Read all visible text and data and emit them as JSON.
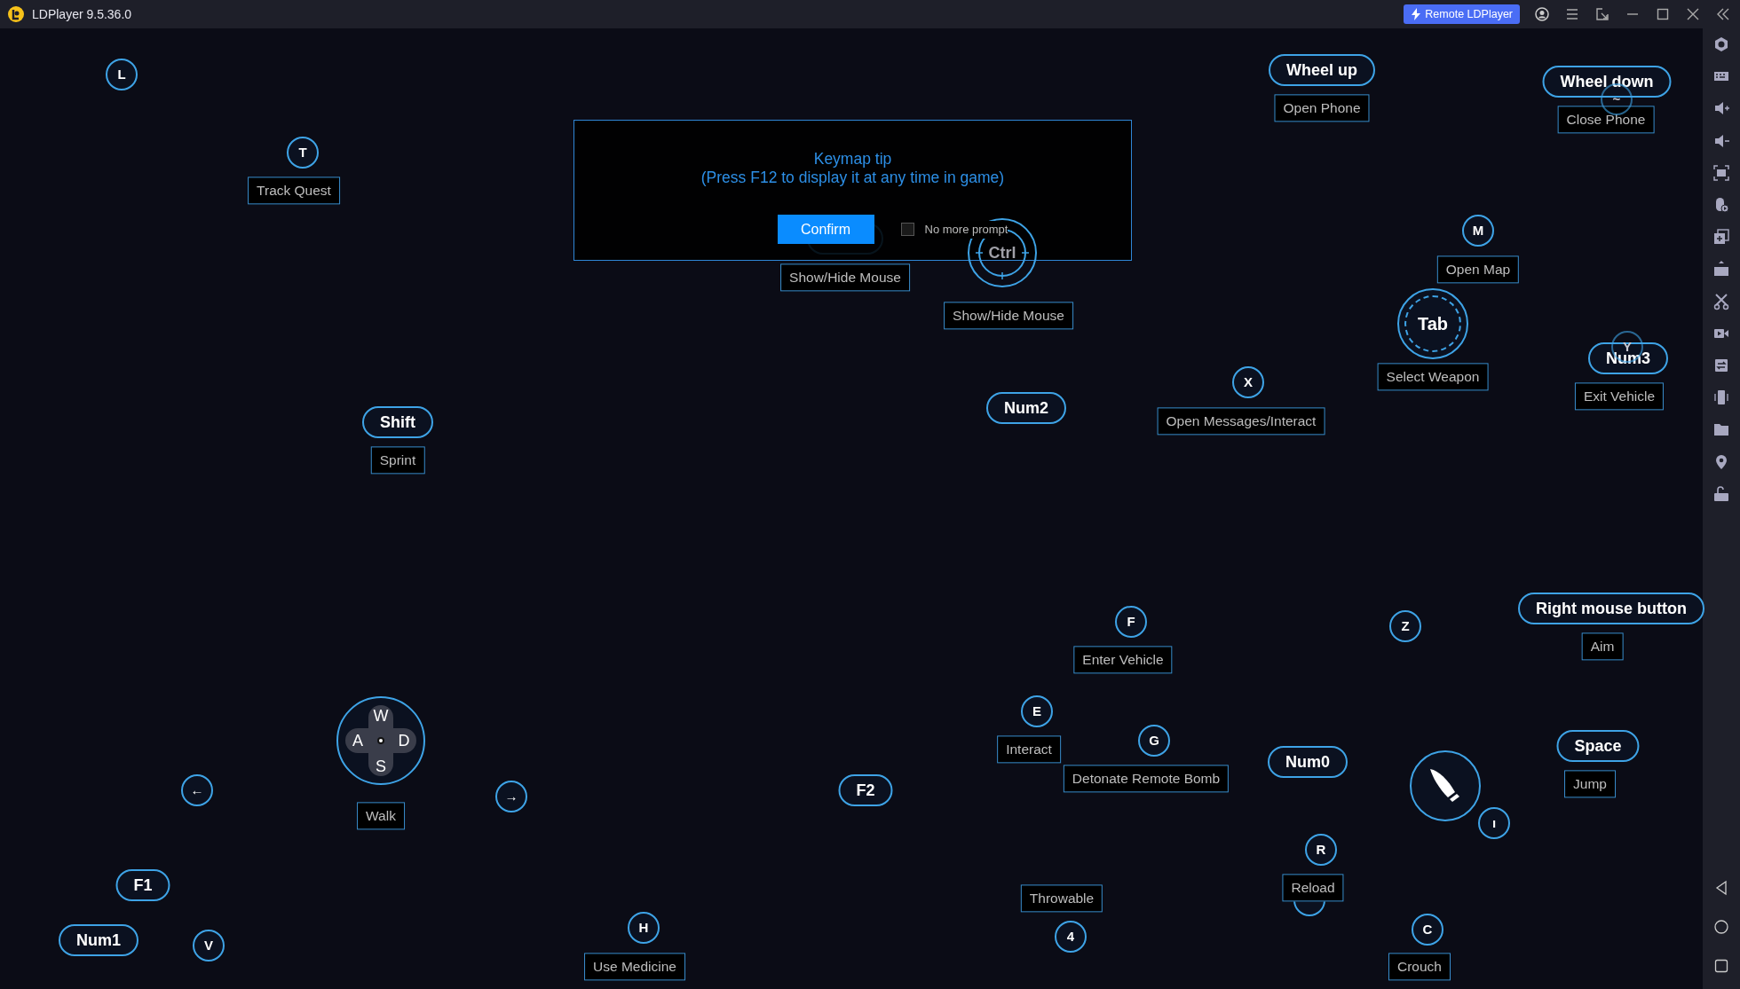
{
  "title_bar": {
    "title": "LDPlayer 9.5.36.0",
    "remote_button": "Remote LDPlayer"
  },
  "dialog": {
    "title": "Keymap tip",
    "subtitle": "(Press F12 to display it at any time in game)",
    "confirm": "Confirm",
    "checkbox": {
      "label": "No more prompt",
      "checked": false
    }
  },
  "keys": [
    {
      "kind": "circle",
      "key": "L"
    },
    {
      "kind": "circle",
      "key": "T",
      "action": "Track Quest"
    },
    {
      "kind": "pill",
      "key": "Wheel up",
      "action": "Open Phone"
    },
    {
      "kind": "pill",
      "key": "Wheel down",
      "action": "Close Phone"
    },
    {
      "kind": "ghost",
      "key": "~"
    },
    {
      "kind": "pill",
      "action": "Show/Hide Mouse"
    },
    {
      "kind": "aim",
      "key": "Ctrl",
      "action": "Show/Hide Mouse"
    },
    {
      "kind": "circle",
      "key": "M",
      "action": "Open Map"
    },
    {
      "kind": "ring",
      "key": "Tab",
      "action": "Select Weapon"
    },
    {
      "kind": "ghost",
      "key": "Y"
    },
    {
      "kind": "pill",
      "key": "Num3",
      "action": "Exit Vehicle"
    },
    {
      "kind": "pill",
      "key": "Num2"
    },
    {
      "kind": "circle",
      "key": "X",
      "action": "Open Messages/Interact"
    },
    {
      "kind": "pill",
      "key": "Shift",
      "action": "Sprint"
    },
    {
      "kind": "circle",
      "key": "F",
      "action": "Enter Vehicle"
    },
    {
      "kind": "circle",
      "key": "Z"
    },
    {
      "kind": "pill",
      "key": "Right mouse button",
      "action": "Aim"
    },
    {
      "kind": "joystick",
      "keys": [
        "W",
        "A",
        "S",
        "D"
      ],
      "action": "Walk"
    },
    {
      "kind": "circle",
      "key": "←"
    },
    {
      "kind": "circle",
      "key": "→"
    },
    {
      "kind": "pill",
      "key": "F2"
    },
    {
      "kind": "circle",
      "key": "E",
      "action": "Interact"
    },
    {
      "kind": "circle",
      "key": "G",
      "action": "Detonate Remote Bomb"
    },
    {
      "kind": "pill",
      "key": "Num0"
    },
    {
      "kind": "fire"
    },
    {
      "kind": "pill",
      "key": "Space",
      "action": "Jump"
    },
    {
      "kind": "circle",
      "key": "ı"
    },
    {
      "kind": "pill",
      "key": "F1"
    },
    {
      "kind": "label",
      "action": "Throwable"
    },
    {
      "kind": "circle"
    },
    {
      "kind": "circle",
      "key": "R",
      "action": "Reload"
    },
    {
      "kind": "pill",
      "key": "Num1"
    },
    {
      "kind": "circle",
      "key": "V"
    },
    {
      "kind": "circle",
      "key": "H",
      "action": "Use Medicine"
    },
    {
      "kind": "circle",
      "key": "4"
    },
    {
      "kind": "circle",
      "key": "C",
      "action": "Crouch"
    }
  ]
}
